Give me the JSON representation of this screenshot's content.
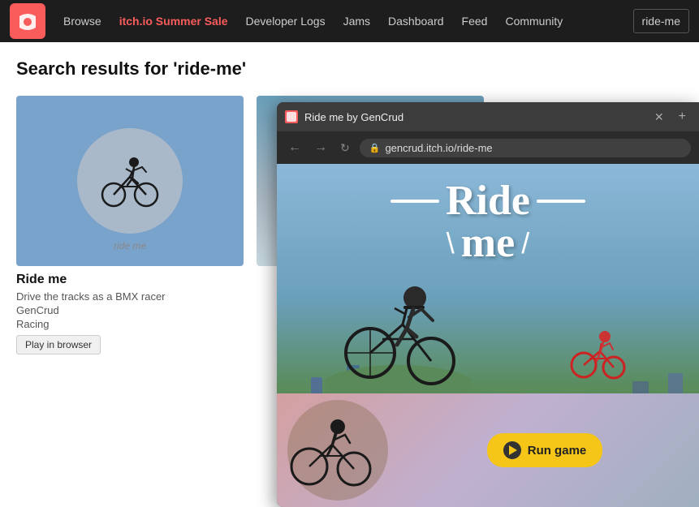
{
  "nav": {
    "logo_alt": "itch.io logo",
    "links": [
      {
        "label": "Browse",
        "class": ""
      },
      {
        "label": "itch.io Summer Sale",
        "class": "sale"
      },
      {
        "label": "Developer Logs",
        "class": ""
      },
      {
        "label": "Jams",
        "class": ""
      },
      {
        "label": "Dashboard",
        "class": ""
      },
      {
        "label": "Feed",
        "class": ""
      },
      {
        "label": "Community",
        "class": ""
      }
    ],
    "username": "ride-me"
  },
  "search": {
    "heading": "Search results for 'ride-me'"
  },
  "game_card": {
    "title": "Ride me",
    "description": "Drive the tracks as a BMX racer",
    "developer": "GenCrud",
    "genre": "Racing",
    "play_btn": "Play in browser",
    "thumb_label": "ride me"
  },
  "browser": {
    "tab_title": "Ride me by GenCrud",
    "url": "gencrud.itch.io/ride-me",
    "game_title_line1": "Ride",
    "game_title_line2": "me",
    "run_game_label": "Run game"
  }
}
